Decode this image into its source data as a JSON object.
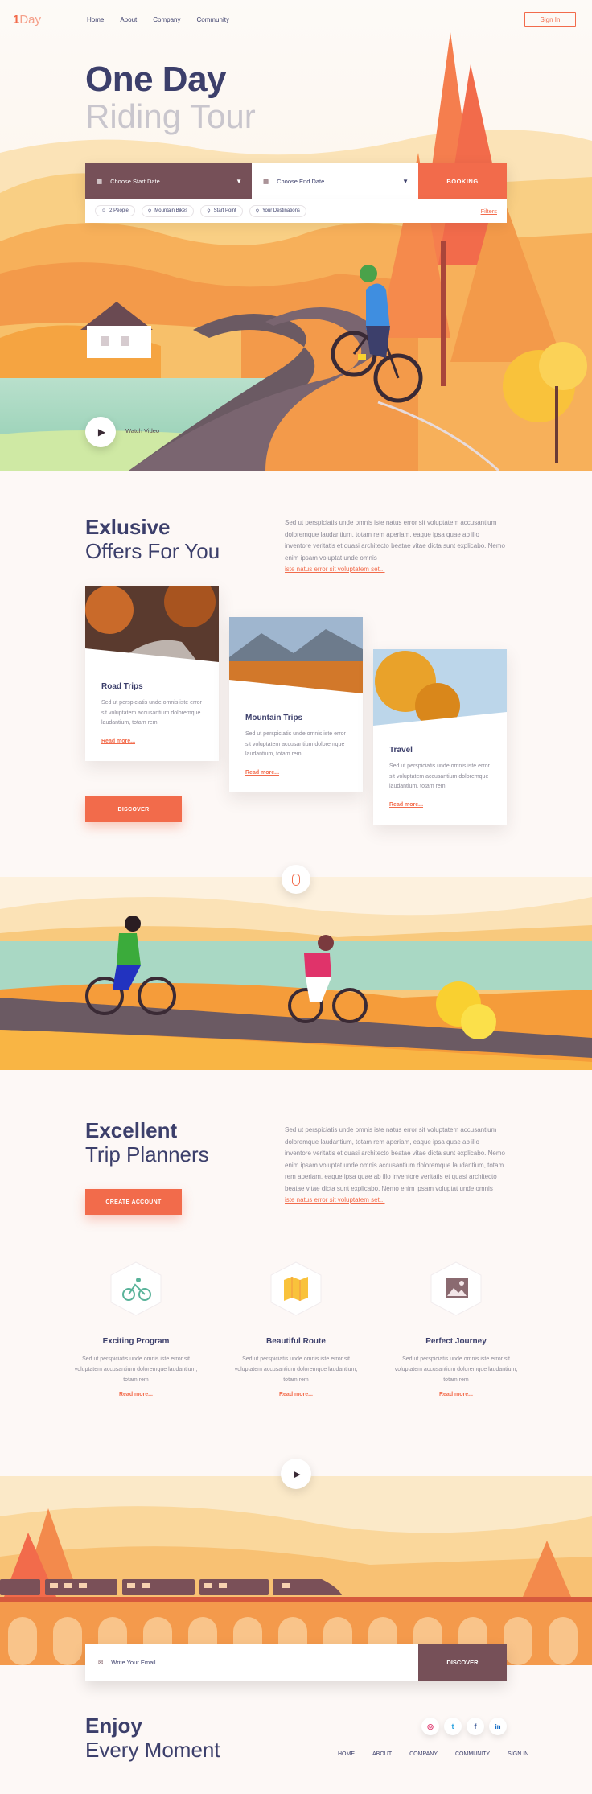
{
  "nav": {
    "logo_strong": "1",
    "logo_rest": "Day",
    "items": [
      "Home",
      "About",
      "Company",
      "Community"
    ],
    "signin": "Sign In"
  },
  "hero": {
    "title_bold": "One Day",
    "title_light": "Riding Tour",
    "start_date": "Choose Start Date",
    "end_date": "Choose End Date",
    "booking": "BOOKING",
    "chips": [
      "2 People",
      "Mountain Bikes",
      "Start Point",
      "Your Destinations"
    ],
    "filters": "Filters",
    "watch": "Watch Video"
  },
  "offers": {
    "title_bold": "Exlusive",
    "title_light": "Offers For You",
    "para": "Sed ut perspiciatis unde omnis iste natus error sit voluptatem accusantium doloremque laudantium, totam rem aperiam, eaque ipsa quae ab illo inventore veritatis et quasi architecto beatae vitae dicta sunt explicabo. Nemo enim ipsam voluptat unde omnis",
    "link": "iste natus error sit voluptatem set...",
    "cards": [
      {
        "title": "Road Trips",
        "text": "Sed ut perspiciatis unde omnis iste error sit voluptatem accusantium doloremque laudantium, totam rem",
        "more": "Read more..."
      },
      {
        "title": "Mountain Trips",
        "text": "Sed ut perspiciatis unde omnis iste error sit voluptatem accusantium doloremque laudantium, totam rem",
        "more": "Read more..."
      },
      {
        "title": "Travel",
        "text": "Sed ut perspiciatis unde omnis iste error sit voluptatem accusantium doloremque laudantium, totam rem",
        "more": "Read more..."
      }
    ],
    "discover": "DISCOVER"
  },
  "planners": {
    "title_bold": "Excellent",
    "title_light": "Trip Planners",
    "para": "Sed ut perspiciatis unde omnis iste natus error sit voluptatem accusantium doloremque laudantium, totam rem aperiam, eaque ipsa quae ab illo inventore veritatis et quasi architecto beatae vitae dicta sunt explicabo. Nemo enim ipsam voluptat unde omnis accusantium doloremque laudantium, totam rem aperiam, eaque ipsa quae ab illo inventore veritatis et quasi architecto beatae vitae dicta sunt explicabo. Nemo enim ipsam voluptat unde omnis",
    "link": "iste natus error sit voluptatem set...",
    "create": "CREATE ACCOUNT",
    "features": [
      {
        "title": "Exciting Program",
        "text": "Sed ut perspiciatis unde omnis iste error sit voluptatem accusantium doloremque laudantium, totam rem",
        "more": "Read more..."
      },
      {
        "title": "Beautiful Route",
        "text": "Sed ut perspiciatis unde omnis iste error sit voluptatem accusantium doloremque laudantium, totam rem",
        "more": "Read more..."
      },
      {
        "title": "Perfect Journey",
        "text": "Sed ut perspiciatis unde omnis iste error sit voluptatem accusantium doloremque laudantium, totam rem",
        "more": "Read more..."
      }
    ]
  },
  "newsletter": {
    "placeholder": "Write Your Email",
    "button": "DISCOVER"
  },
  "footer": {
    "title_bold": "Enjoy",
    "title_light": "Every Moment",
    "social": [
      "instagram-icon",
      "twitter-icon",
      "facebook-icon",
      "linkedin-icon"
    ],
    "social_glyphs": [
      "◎",
      "t",
      "f",
      "in"
    ],
    "links": [
      "HOME",
      "ABOUT",
      "COMPANY",
      "COMMUNITY",
      "SIGN IN"
    ]
  },
  "colors": {
    "accent": "#f26b4b",
    "plum": "#765058",
    "navy": "#3c3f6b"
  }
}
